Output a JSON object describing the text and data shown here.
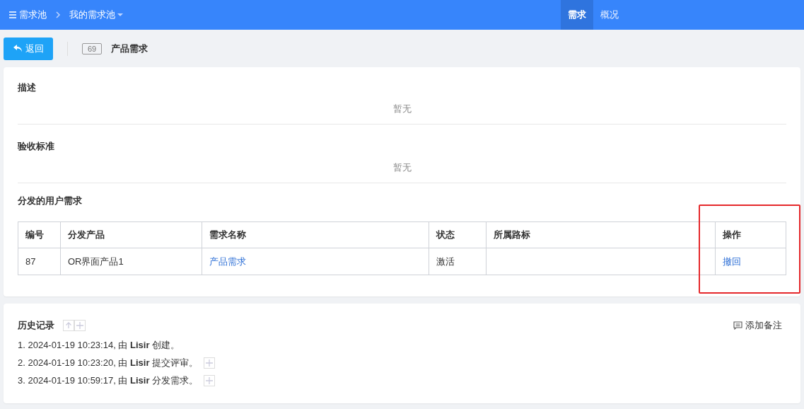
{
  "topbar": {
    "breadcrumb": [
      {
        "label": "需求池"
      },
      {
        "label": "我的需求池"
      }
    ],
    "nav": [
      {
        "label": "需求",
        "selected": true
      },
      {
        "label": "概况",
        "selected": false
      }
    ]
  },
  "toolbar": {
    "back_button": "返回",
    "id": "69",
    "title": "产品需求"
  },
  "sections": [
    {
      "title": "描述",
      "content": "暂无"
    },
    {
      "title": "验收标准",
      "content": "暂无"
    }
  ],
  "distributed": {
    "title": "分发的用户需求",
    "columns": [
      {
        "label": "编号",
        "highlighted": false
      },
      {
        "label": "分发产品",
        "highlighted": false
      },
      {
        "label": "需求名称",
        "highlighted": false
      },
      {
        "label": "状态",
        "highlighted": false
      },
      {
        "label": "所属路标",
        "highlighted": false
      },
      {
        "label": "操作",
        "highlighted": true
      }
    ],
    "rows": [
      {
        "cells": [
          {
            "text": "87",
            "kind": "text"
          },
          {
            "text": "OR界面产品1",
            "kind": "text"
          },
          {
            "text": "产品需求",
            "kind": "link"
          },
          {
            "text": "激活",
            "kind": "text"
          },
          {
            "text": "",
            "kind": "text"
          },
          {
            "text": "撤回",
            "kind": "link"
          }
        ]
      }
    ]
  },
  "history": {
    "title": "历史记录",
    "add_note": "添加备注",
    "entries": [
      {
        "text": "1. 2024-01-19 10:23:14, 由 **Lisir** 创建。",
        "expandable": false
      },
      {
        "text": "2. 2024-01-19 10:23:20, 由 **Lisir** 提交评审。",
        "expandable": true
      },
      {
        "text": "3. 2024-01-19 10:59:17, 由 **Lisir** 分发需求。",
        "expandable": true
      }
    ]
  }
}
